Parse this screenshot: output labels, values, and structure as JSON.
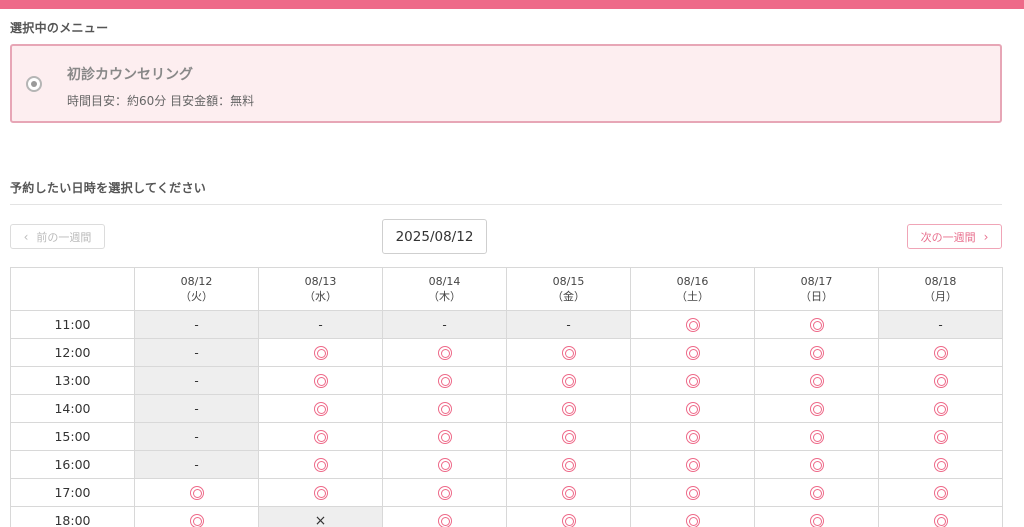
{
  "selected_menu_heading": "選択中のメニュー",
  "menu": {
    "name": "初診カウンセリング",
    "detail": "時間目安：約60分  目安金額：無料"
  },
  "date_heading": "予約したい日時を選択してください",
  "nav": {
    "prev_label": "前の一週間",
    "next_label": "次の一週間",
    "prev_chevron": "‹",
    "next_chevron": "›",
    "current_date": "2025/08/12"
  },
  "schedule": {
    "days": [
      {
        "date": "08/12",
        "weekday": "（火）"
      },
      {
        "date": "08/13",
        "weekday": "（水）"
      },
      {
        "date": "08/14",
        "weekday": "（木）"
      },
      {
        "date": "08/15",
        "weekday": "（金）"
      },
      {
        "date": "08/16",
        "weekday": "（土）"
      },
      {
        "date": "08/17",
        "weekday": "（日）"
      },
      {
        "date": "08/18",
        "weekday": "（月）"
      }
    ],
    "legend": {
      "available": "◎",
      "unavailable": "-",
      "full": "×"
    },
    "rows": [
      {
        "time": "11:00",
        "slots": [
          "-",
          "-",
          "-",
          "-",
          "◎",
          "◎",
          "-"
        ]
      },
      {
        "time": "12:00",
        "slots": [
          "-",
          "◎",
          "◎",
          "◎",
          "◎",
          "◎",
          "◎"
        ]
      },
      {
        "time": "13:00",
        "slots": [
          "-",
          "◎",
          "◎",
          "◎",
          "◎",
          "◎",
          "◎"
        ]
      },
      {
        "time": "14:00",
        "slots": [
          "-",
          "◎",
          "◎",
          "◎",
          "◎",
          "◎",
          "◎"
        ]
      },
      {
        "time": "15:00",
        "slots": [
          "-",
          "◎",
          "◎",
          "◎",
          "◎",
          "◎",
          "◎"
        ]
      },
      {
        "time": "16:00",
        "slots": [
          "-",
          "◎",
          "◎",
          "◎",
          "◎",
          "◎",
          "◎"
        ]
      },
      {
        "time": "17:00",
        "slots": [
          "◎",
          "◎",
          "◎",
          "◎",
          "◎",
          "◎",
          "◎"
        ]
      },
      {
        "time": "18:00",
        "slots": [
          "◎",
          "×",
          "◎",
          "◎",
          "◎",
          "◎",
          "◎"
        ]
      }
    ]
  },
  "colors": {
    "accent": "#ee6a89",
    "card_bg": "#fdeef0",
    "card_border": "#e7a6b6",
    "unavailable_bg": "#eeeeee"
  }
}
